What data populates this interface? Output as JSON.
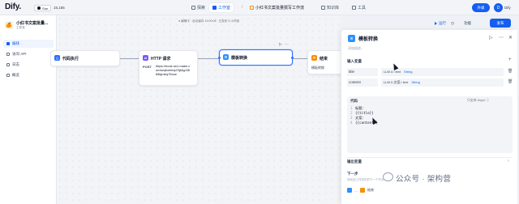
{
  "topbar": {
    "logo": "Dify.",
    "github_label": "Star",
    "github_count": "15,155",
    "nav": [
      {
        "label": "探索",
        "icon": "compass-icon"
      },
      {
        "label": "工作室",
        "icon": "studio-icon"
      },
      {
        "label": "小红书文案批量撰写工作流",
        "icon": "app-icon"
      },
      {
        "label": "知识库",
        "icon": "book-icon"
      },
      {
        "label": "工具",
        "icon": "tools-icon"
      }
    ],
    "upgrade_label": "升级",
    "avatar_letter": "D",
    "user_name": "Dify"
  },
  "sidebar": {
    "app_icon": "🍊",
    "app_name": "小红书文案批量...",
    "app_type": "工作流",
    "items": [
      {
        "label": "编排",
        "active": true
      },
      {
        "label": "访问 API",
        "active": false
      },
      {
        "label": "日志",
        "active": false
      },
      {
        "label": "概览",
        "active": false
      }
    ]
  },
  "canvas": {
    "status": "● 编辑中 · 自动保存 15:09:08 · 已发布 8 小时前",
    "nodes": {
      "code": {
        "title": "代码执行"
      },
      "http": {
        "title": "HTTP 请求",
        "method": "POST",
        "url": "https://hook.us1.make.com/wqfxnhfnpi7tjkfyp3868kjmbq76nce"
      },
      "template": {
        "title": "模板转换"
      },
      "end": {
        "title": "结束",
        "output": "模板转换",
        "more": "(4) output"
      }
    }
  },
  "toolbar": {
    "run_label": "运行",
    "features_label": "功能",
    "publish_label": "发布"
  },
  "panel": {
    "title": "模板转换",
    "description": "添加描述...",
    "input_section": "输入变量",
    "variables": [
      {
        "name": "title",
        "source": "LLM 4 / text",
        "type": "String"
      },
      {
        "name": "content",
        "source": "LLM 2-文案 / text",
        "type": "String"
      }
    ],
    "code_label": "代码",
    "code_tools": "只支持 Jinja2 ⓘ",
    "code_lines": [
      "标题：",
      "{{title}}",
      "文案：",
      "{{content}}"
    ],
    "output_section": "输出变量",
    "next_label": "下一步",
    "next_desc": "添加此工作流中的下一个节点",
    "next_from": "模板转换",
    "next_to": "结束"
  },
  "watermark": "公众号 · 架构营",
  "colors": {
    "accent": "#155eef",
    "code_node": "#2970ff",
    "http_node": "#7a5af8",
    "template_node": "#2e90fa",
    "end_node": "#f79009"
  }
}
